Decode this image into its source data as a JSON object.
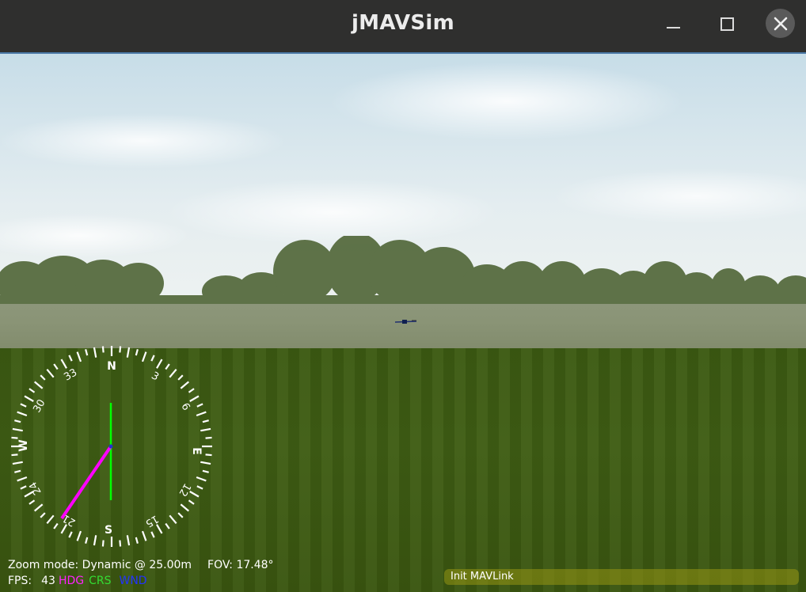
{
  "window": {
    "title": "jMAVSim",
    "buttons": {
      "minimize_icon": "minimize-icon",
      "maximize_icon": "maximize-icon",
      "close_icon": "close-icon"
    }
  },
  "compass": {
    "cardinals": [
      "N",
      "E",
      "S",
      "W"
    ],
    "numbers": [
      "3",
      "6",
      "12",
      "15",
      "21",
      "24",
      "30",
      "33"
    ],
    "heading_color": "#ff00ff",
    "course_color": "#00ff00"
  },
  "hud": {
    "zoom_label": "Zoom mode: Dynamic @ 25.00m",
    "fov_label": "FOV: 17.48°",
    "fps_label": "FPS:",
    "fps_value": "43",
    "hdg_label": "HDG",
    "crs_label": "CRS",
    "wnd_label": "WND",
    "colors": {
      "hdg": "#ff22ff",
      "crs": "#33dd33",
      "wnd": "#2233ff"
    }
  },
  "status": {
    "message": "Init MAVLink"
  }
}
